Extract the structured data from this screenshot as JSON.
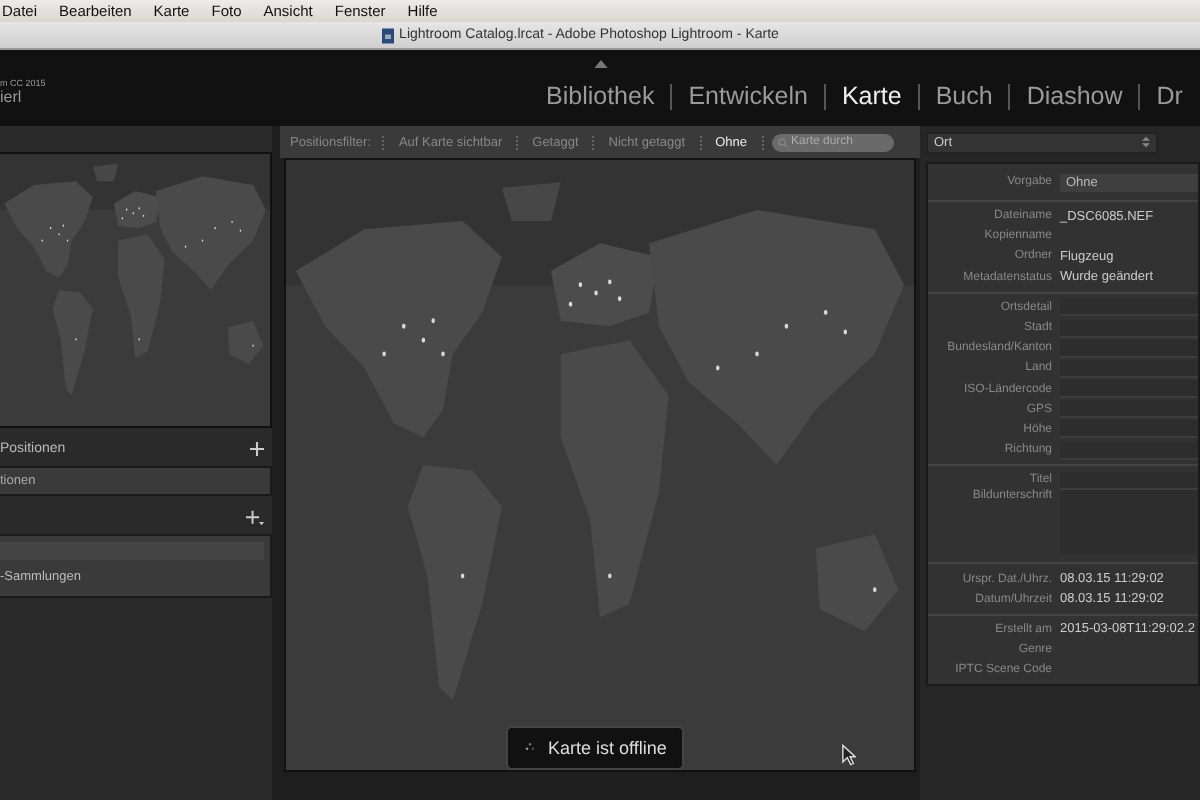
{
  "menu_bar": {
    "items": [
      "Datei",
      "Bearbeiten",
      "Karte",
      "Foto",
      "Ansicht",
      "Fenster",
      "Hilfe"
    ]
  },
  "window": {
    "title": "Lightroom Catalog.lrcat - Adobe Photoshop Lightroom - Karte"
  },
  "identity_plate": {
    "line_1": "m CC 2015",
    "line_2": "ierl"
  },
  "modules": [
    {
      "label": "Bibliothek",
      "selected": false
    },
    {
      "label": "Entwickeln",
      "selected": false
    },
    {
      "label": "Karte",
      "selected": true
    },
    {
      "label": "Buch",
      "selected": false
    },
    {
      "label": "Diashow",
      "selected": false
    },
    {
      "label": "Dr",
      "selected": false
    }
  ],
  "left_panel": {
    "saved_locations": {
      "title": "Positionen",
      "field_value": "tionen"
    },
    "collections": {
      "items": [
        {
          "label": "-Sammlungen"
        }
      ]
    }
  },
  "filter_bar": {
    "label": "Positionsfilter:",
    "options": [
      {
        "label": "Auf Karte sichtbar",
        "selected": false
      },
      {
        "label": "Getaggt",
        "selected": false
      },
      {
        "label": "Nicht getaggt",
        "selected": false
      },
      {
        "label": "Ohne",
        "selected": true
      }
    ],
    "search_placeholder": "Karte durch"
  },
  "map": {
    "status": "Karte ist offline"
  },
  "right_panel": {
    "dropdown": "Ort",
    "preset": {
      "label": "Vorgabe",
      "value": "Ohne"
    },
    "groups": [
      [
        {
          "label": "Dateiname",
          "kind": "text",
          "value": "_DSC6085.NEF"
        },
        {
          "label": "Kopienname",
          "kind": "text"
        },
        {
          "label": "Ordner",
          "kind": "text",
          "value": "Flugzeug"
        },
        {
          "label": "Metadatenstatus",
          "kind": "text",
          "value": "Wurde geändert"
        }
      ],
      [
        {
          "label": "Ortsdetail",
          "kind": "field"
        },
        {
          "label": "Stadt",
          "kind": "field"
        },
        {
          "label": "Bundesland/Kanton",
          "kind": "field"
        },
        {
          "label": "Land",
          "kind": "field"
        },
        {
          "label": "ISO-Ländercode",
          "kind": "field"
        },
        {
          "label": "GPS",
          "kind": "field"
        },
        {
          "label": "Höhe",
          "kind": "field"
        },
        {
          "label": "Richtung",
          "kind": "field"
        }
      ],
      [
        {
          "label": "Titel",
          "kind": "field"
        },
        {
          "label": "Bildunterschrift",
          "kind": "area"
        }
      ],
      [
        {
          "label": "Urspr. Dat./Uhrz.",
          "kind": "text",
          "value": "08.03.15 11:29:02"
        },
        {
          "label": "Datum/Uhrzeit",
          "kind": "text",
          "value": "08.03.15 11:29:02"
        }
      ],
      [
        {
          "label": "Erstellt am",
          "kind": "text",
          "value": "2015-03-08T11:29:02.2"
        },
        {
          "label": "Genre",
          "kind": "text"
        },
        {
          "label": "IPTC Scene Code",
          "kind": "text"
        }
      ]
    ]
  }
}
